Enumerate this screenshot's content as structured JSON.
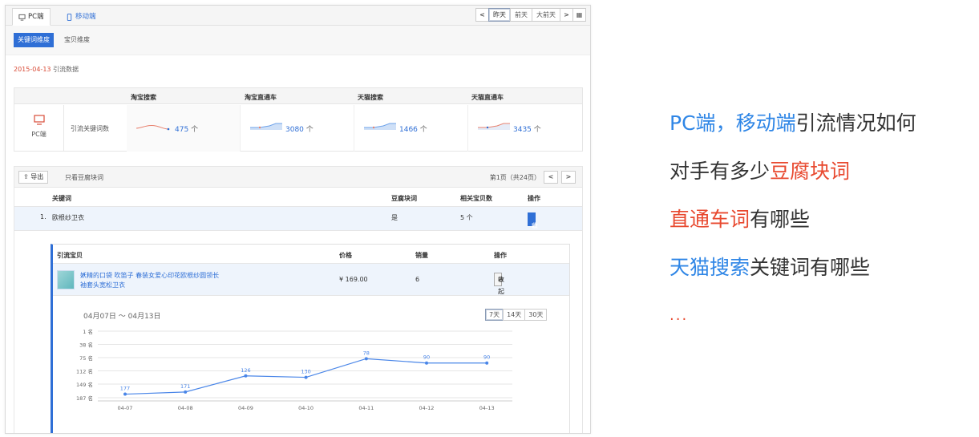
{
  "tabs": {
    "pc": "PC端",
    "mobile": "移动端"
  },
  "days": {
    "prev": "<",
    "yesterday": "昨天",
    "day_before": "前天",
    "three_days": "大前天",
    "next": ">",
    "cal": "▦"
  },
  "dimension": {
    "keyword": "关键词维度",
    "item": "宝贝维度"
  },
  "date_line": {
    "date": "2015-04-13",
    "label": "引流数据"
  },
  "summary": {
    "headers": [
      "淘宝搜索",
      "淘宝直通车",
      "天猫搜索",
      "天猫直通车"
    ],
    "device_label": "PC端",
    "row_label": "引流关键词数",
    "values": [
      "475",
      "3080",
      "1466",
      "3435"
    ],
    "unit": "个"
  },
  "kw_toolbar": {
    "export": "导出",
    "only_tofu": "只看豆腐块词",
    "page_info": "第1页（共24页）",
    "prev": "<",
    "next": ">"
  },
  "kw_table": {
    "headers": [
      "关键词",
      "豆腐块词",
      "相关宝贝数",
      "操作"
    ],
    "rows": [
      {
        "idx": "1.",
        "keyword": "欧根纱卫衣",
        "tofu": "是",
        "count": "5 个",
        "action": "收起"
      }
    ]
  },
  "detail": {
    "headers": [
      "引流宝贝",
      "价格",
      "销量",
      "操作"
    ],
    "item_title": "妖精的口袋 吹笛子 春装女爱心印花欧根纱圆领长袖套头宽松卫衣",
    "price": "¥ 169.00",
    "sales": "6",
    "action": "收起",
    "range": "04月07日 ～ 04月13日",
    "range_btns": [
      "7天",
      "14天",
      "30天"
    ]
  },
  "chart_data": {
    "type": "line",
    "x": [
      "04-07",
      "04-08",
      "04-09",
      "04-10",
      "04-11",
      "04-12",
      "04-13"
    ],
    "values": [
      177,
      171,
      126,
      130,
      78,
      90,
      90
    ],
    "y_ticks": [
      "1 名",
      "38 名",
      "75 名",
      "112 名",
      "149 名",
      "187 名"
    ],
    "y_tick_values": [
      1,
      38,
      75,
      112,
      149,
      187
    ],
    "ylim": [
      1,
      187
    ],
    "inverted": true,
    "color": "#4a86e8"
  },
  "right_text": {
    "l1_b1": "PC端",
    "l1_sep": "，",
    "l1_b2": "移动端",
    "l1_t": "引流情况如何",
    "l2_t": "对手有多少",
    "l2_r": "豆腐块词",
    "l3_r": "直通车词",
    "l3_t": "有哪些",
    "l4_b": "天猫搜索",
    "l4_t": "关键词有哪些",
    "dots": "..."
  }
}
